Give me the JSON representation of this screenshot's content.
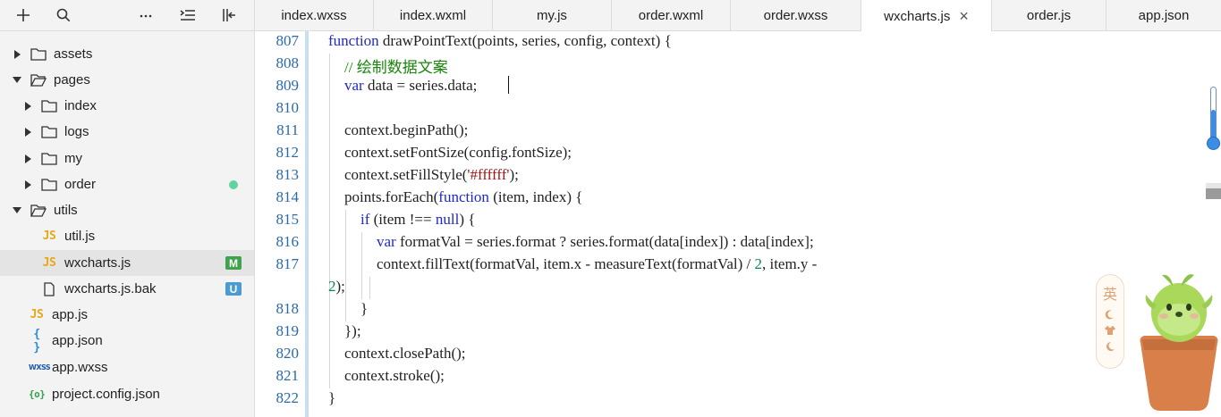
{
  "sidebar": {
    "toolbar": {
      "add_icon": "plus-icon",
      "search_icon": "search-icon",
      "more_icon": "ellipsis-icon",
      "outline_icon": "outline-icon",
      "collapse_icon": "collapse-icon"
    },
    "items": [
      {
        "label": "assets",
        "type": "folder",
        "expanded": false
      },
      {
        "label": "pages",
        "type": "folder",
        "expanded": true
      },
      {
        "label": "index",
        "type": "folder",
        "expanded": false
      },
      {
        "label": "logs",
        "type": "folder",
        "expanded": false
      },
      {
        "label": "my",
        "type": "folder",
        "expanded": false
      },
      {
        "label": "order",
        "type": "folder",
        "expanded": false,
        "status": "modified-dot"
      },
      {
        "label": "utils",
        "type": "folder",
        "expanded": true
      },
      {
        "label": "util.js",
        "type": "js"
      },
      {
        "label": "wxcharts.js",
        "type": "js",
        "selected": true,
        "badge": "M"
      },
      {
        "label": "wxcharts.js.bak",
        "type": "file",
        "badge": "U"
      },
      {
        "label": "app.js",
        "type": "js"
      },
      {
        "label": "app.json",
        "type": "json"
      },
      {
        "label": "app.wxss",
        "type": "wxss"
      },
      {
        "label": "project.config.json",
        "type": "config"
      }
    ],
    "icon_texts": {
      "js": "JS",
      "json": "{ }",
      "wxss": "WXSS",
      "config": "{o}"
    }
  },
  "tabs": [
    {
      "label": "index.wxss"
    },
    {
      "label": "index.wxml"
    },
    {
      "label": "my.js"
    },
    {
      "label": "order.wxml"
    },
    {
      "label": "order.wxss"
    },
    {
      "label": "wxcharts.js",
      "active": true,
      "close": "×"
    },
    {
      "label": "order.js"
    },
    {
      "label": "app.json"
    }
  ],
  "editor": {
    "line_numbers": [
      "807",
      "808",
      "809",
      "810",
      "811",
      "812",
      "813",
      "814",
      "815",
      "816",
      "817",
      "818",
      "819",
      "820",
      "821",
      "822"
    ],
    "code": {
      "l807": {
        "kw": "function",
        "rest": " drawPointText(points, series, config, context) {"
      },
      "l808": {
        "comment": "// 绘制数据文案"
      },
      "l809": {
        "kw": "var",
        "rest": " data = series.data;"
      },
      "l811": "context.beginPath();",
      "l812": "context.setFontSize(config.fontSize);",
      "l813": {
        "pre": "context.setFillStyle(",
        "str": "'#ffffff'",
        "post": ");"
      },
      "l814": {
        "pre": "points.forEach(",
        "kw": "function",
        "post": " (item, index) {"
      },
      "l815": {
        "kw1": "if",
        "mid": " (item !== ",
        "kw2": "null",
        "post": ") {"
      },
      "l816": {
        "kw": "var",
        "rest": " formatVal = series.format ? series.format(data[index]) : data[index];"
      },
      "l817": {
        "pre": "context.fillText(formatVal, item.x - measureText(formatVal) / ",
        "num": "2",
        "post": ", item.y -"
      },
      "l817b": {
        "num": "2",
        "post": ");"
      },
      "l818": "}",
      "l819": "});",
      "l820": "context.closePath();",
      "l821": "context.stroke();",
      "l822": "}"
    }
  },
  "colors": {
    "keyword": "#1f28c8",
    "comment": "#19860b",
    "string": "#a31515",
    "number": "#098658",
    "line_number": "#2a6aa6",
    "modified_badge": "#3fa34d",
    "untracked_badge": "#4a9bd1",
    "modified_dot": "#5fd3a0"
  },
  "ime": {
    "char": "英",
    "icons": [
      "moon-icon",
      "shirt-icon",
      "crescent-icon"
    ]
  },
  "mascot": {
    "icon": "cactus-mascot-icon"
  }
}
